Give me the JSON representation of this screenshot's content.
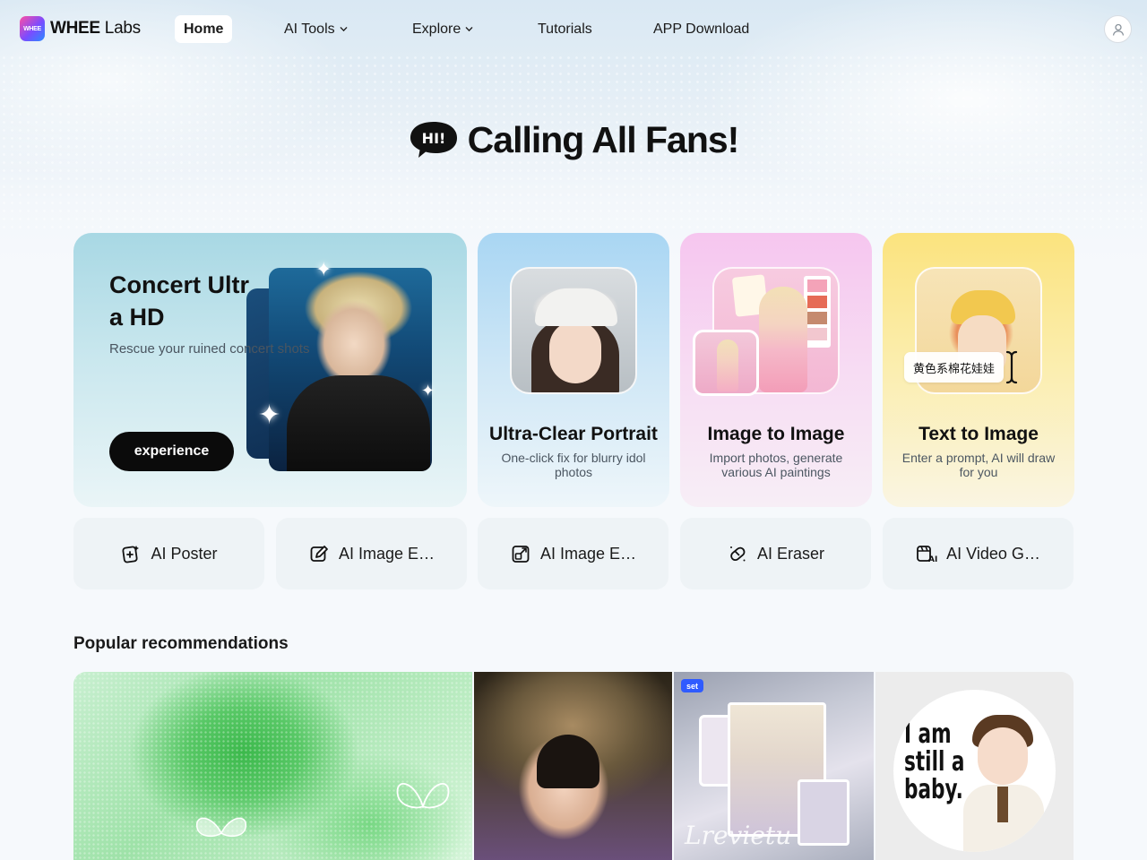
{
  "header": {
    "logo_mark": "WHEE",
    "logo_bold": "WHEE",
    "logo_light": "Labs",
    "nav": [
      {
        "label": "Home",
        "active": true,
        "has_dropdown": false
      },
      {
        "label": "AI Tools",
        "active": false,
        "has_dropdown": true
      },
      {
        "label": "Explore",
        "active": false,
        "has_dropdown": true
      },
      {
        "label": "Tutorials",
        "active": false,
        "has_dropdown": false
      },
      {
        "label": "APP Download",
        "active": false,
        "has_dropdown": false
      }
    ],
    "avatar_icon": "user-icon"
  },
  "hero": {
    "badge_text": "HI!",
    "title": "Calling All Fans!"
  },
  "feature_cards": {
    "main": {
      "title": "Concert Ultra HD",
      "subtitle": "Rescue your ruined concert shots",
      "button": "experience"
    },
    "cards": [
      {
        "title": "Ultra-Clear Portrait",
        "desc": "One-click fix for blurry idol photos"
      },
      {
        "title": "Image to Image",
        "desc": "Import photos, generate various AI paintings"
      },
      {
        "title": "Text to Image",
        "desc": "Enter a prompt, AI will draw for you",
        "prompt": "黄色系棉花娃娃"
      }
    ]
  },
  "tools": [
    {
      "label": "AI Poster",
      "icon": "poster-icon"
    },
    {
      "label": "AI Image E…",
      "icon": "image-edit-icon"
    },
    {
      "label": "AI Image E…",
      "icon": "image-expand-icon"
    },
    {
      "label": "AI Eraser",
      "icon": "eraser-icon"
    },
    {
      "label": "AI Video G…",
      "icon": "video-generator-icon"
    }
  ],
  "popular": {
    "title": "Popular recommendations",
    "items": [
      {
        "badge": ""
      },
      {
        "badge": ""
      },
      {
        "badge": "set",
        "script": "Lrevietu"
      },
      {
        "badge": "",
        "stamp": "I am still a baby."
      }
    ]
  },
  "colors": {
    "accent_dark": "#0b0b0b",
    "set_badge": "#2f5bff",
    "card_blue": "#a8d8e4",
    "card_pink": "#f6c6ef",
    "card_yellow": "#fbe37e"
  }
}
